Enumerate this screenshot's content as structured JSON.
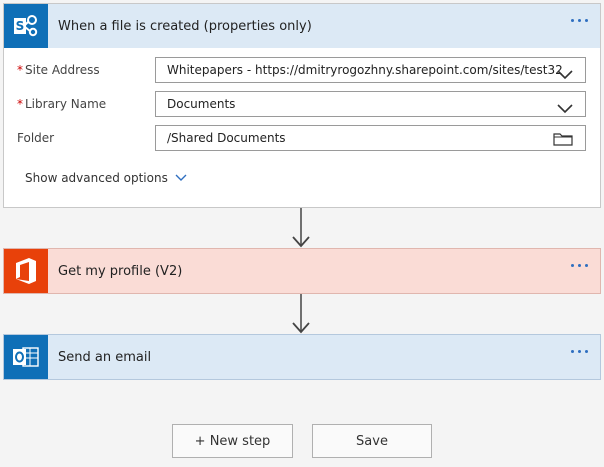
{
  "trigger": {
    "title": "When a file is created (properties only)",
    "icon": "sharepoint-icon",
    "fields": [
      {
        "label": "Site Address",
        "required": true,
        "value": "Whitepapers - https://dmitryrogozhny.sharepoint.com/sites/test32",
        "control": "chevron-down-icon"
      },
      {
        "label": "Library Name",
        "required": true,
        "value": "Documents",
        "control": "chevron-down-icon"
      },
      {
        "label": "Folder",
        "required": false,
        "value": "/Shared Documents",
        "control": "folder-icon"
      }
    ],
    "advanced_label": "Show advanced options"
  },
  "step2": {
    "title": "Get my profile (V2)",
    "icon": "office-icon"
  },
  "step3": {
    "title": "Send an email",
    "icon": "outlook-icon"
  },
  "buttons": {
    "new_step": "+ New step",
    "save": "Save"
  },
  "colors": {
    "blue_header": "#dce9f5",
    "sharepoint_blue": "#0f6fb7",
    "office_red": "#e8410a",
    "office_header": "#fadcd6",
    "required_star": "#c00000"
  }
}
